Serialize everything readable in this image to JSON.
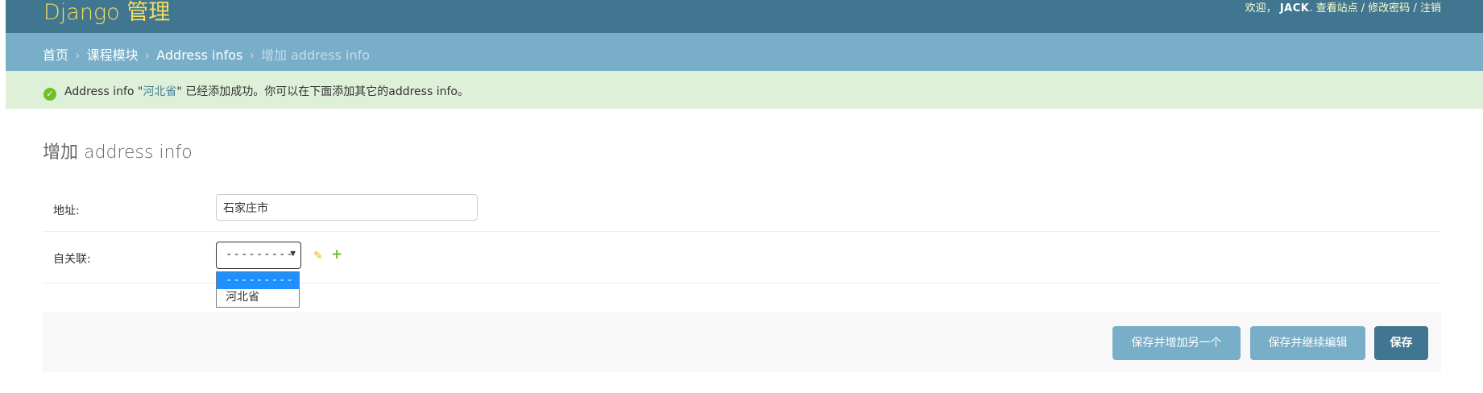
{
  "header": {
    "branding": "Django 管理",
    "welcome": "欢迎，",
    "username": "JACK",
    "view_site": "查看站点",
    "change_password": "修改密码",
    "logout": "注销",
    "separator": "/"
  },
  "breadcrumbs": {
    "items": [
      "首页",
      "课程模块",
      "Address infos"
    ],
    "current": "增加 address info",
    "separator": "›"
  },
  "message": {
    "prefix": "Address info \"",
    "object_link": "河北省",
    "suffix": "\" 已经添加成功。你可以在下面添加其它的address info。"
  },
  "page_title": "增加 address info",
  "form": {
    "address": {
      "label": "地址:",
      "value": "石家庄市"
    },
    "parent": {
      "label": "自关联:",
      "selected": "---------",
      "options": [
        "---------",
        "河北省"
      ]
    }
  },
  "buttons": {
    "save_add_another": "保存并增加另一个",
    "save_continue": "保存并继续编辑",
    "save": "保存"
  },
  "colors": {
    "header_bg": "#417690",
    "breadcrumbs_bg": "#79aec8",
    "success_bg": "#dff0d8",
    "branding_text": "#f5dd5d",
    "save_button": "#417690",
    "secondary_button": "#79aec8",
    "dropdown_highlight": "#1e90ff"
  },
  "icons": {
    "success": "check-circle-icon",
    "edit_related": "pencil-icon",
    "add_related": "plus-icon",
    "select_arrow": "triangle-down-icon"
  }
}
